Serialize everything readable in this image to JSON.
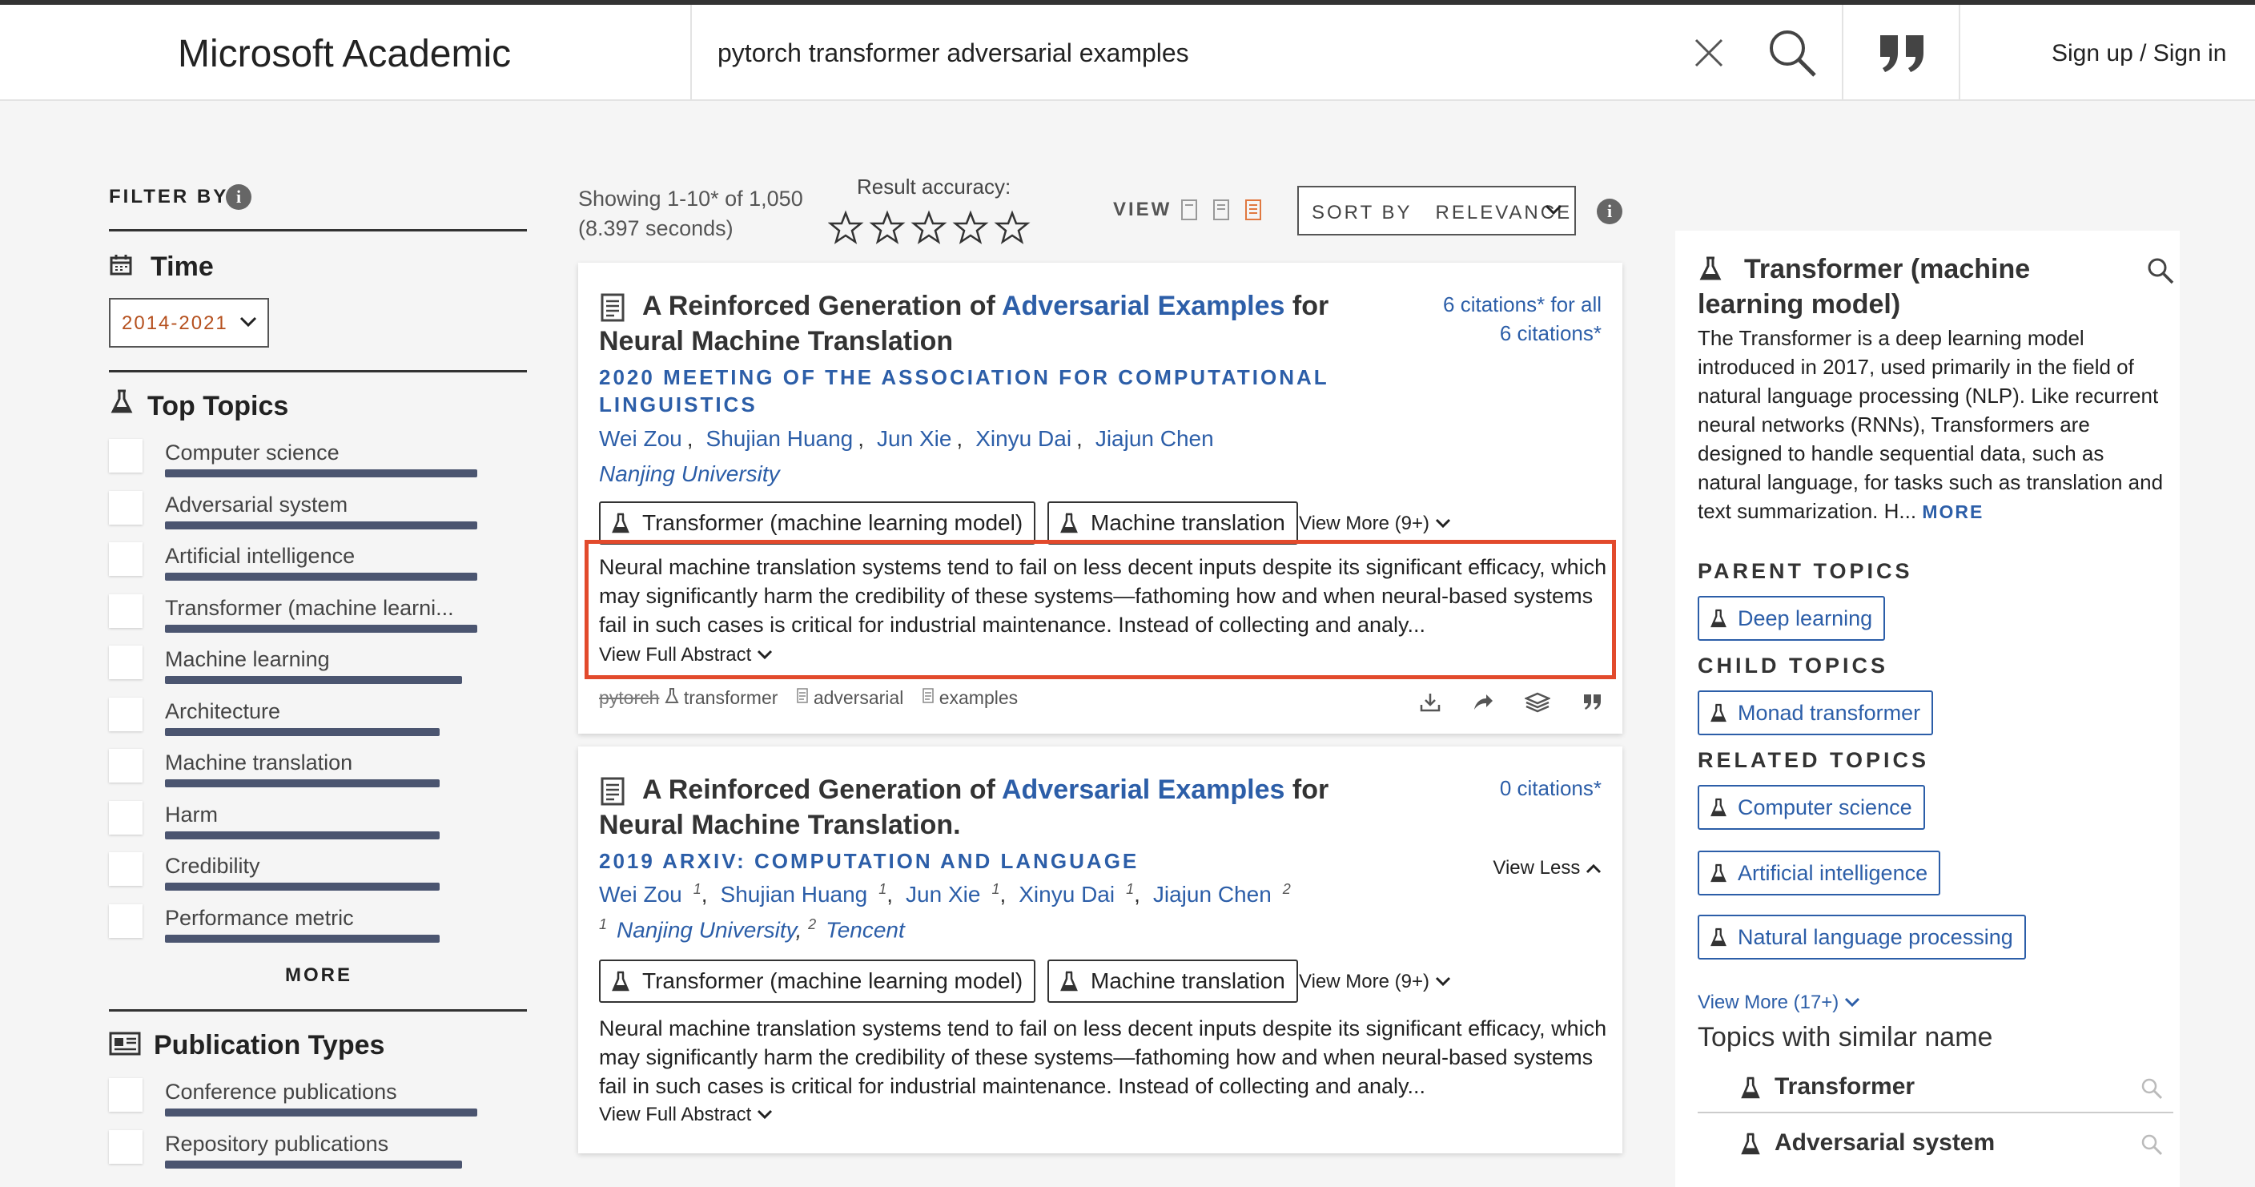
{
  "header": {
    "brand": "Microsoft Academic",
    "search_value": "pytorch transformer adversarial examples",
    "signin": "Sign up / Sign in"
  },
  "filters": {
    "label": "FILTER BY:",
    "time": {
      "title": "Time",
      "selected": "2014-2021"
    },
    "top_topics": {
      "title": "Top Topics",
      "items": [
        {
          "label": "Computer science",
          "weight": 1.0
        },
        {
          "label": "Adversarial system",
          "weight": 1.0
        },
        {
          "label": "Artificial intelligence",
          "weight": 1.0
        },
        {
          "label": "Transformer (machine learni...",
          "weight": 1.0
        },
        {
          "label": "Machine learning",
          "weight": 0.95
        },
        {
          "label": "Architecture",
          "weight": 0.88
        },
        {
          "label": "Machine translation",
          "weight": 0.88
        },
        {
          "label": "Harm",
          "weight": 0.88
        },
        {
          "label": "Credibility",
          "weight": 0.88
        },
        {
          "label": "Performance metric",
          "weight": 0.88
        }
      ],
      "more": "MORE"
    },
    "publication_types": {
      "title": "Publication Types",
      "items": [
        {
          "label": "Conference publications",
          "weight": 1.0
        },
        {
          "label": "Repository publications",
          "weight": 0.95
        }
      ]
    }
  },
  "results_header": {
    "showing": "Showing 1-10* of 1,050",
    "seconds": "(8.397 seconds)",
    "accuracy_label": "Result accuracy:",
    "view_label": "VIEW",
    "sort_label": "SORT BY",
    "sort_value": "RELEVANCE"
  },
  "results": [
    {
      "title_pre": "A Reinforced Generation of ",
      "title_hl": "Adversarial Examples",
      "title_post": " for Neural Machine Translation",
      "cites_line1": "6 citations* for all",
      "cites_line2": "6 citations*",
      "venue": "2020 MEETING OF THE ASSOCIATION FOR COMPUTATIONAL LINGUISTICS",
      "authors": [
        "Wei Zou",
        "Shujian Huang",
        "Jun Xie",
        "Xinyu Dai",
        "Jiajun Chen"
      ],
      "affiliation": "Nanjing University",
      "chips": [
        "Transformer (machine learning model)",
        "Machine translation"
      ],
      "view_more": "View More (9+)",
      "abstract": "Neural machine translation systems tend to fail on less decent inputs despite its significant efficacy, which may significantly harm the credibility of these systems—fathoming how and when neural-based systems fail in such cases is critical for industrial maintenance. Instead of collecting and analy...",
      "full_abstract": "View Full Abstract",
      "keywords": {
        "struck": "pytorch",
        "k1": "transformer",
        "k2": "adversarial",
        "k3": "examples"
      }
    },
    {
      "title_pre": "A Reinforced Generation of ",
      "title_hl": "Adversarial Examples",
      "title_post": " for Neural Machine Translation.",
      "cites_line1": "0 citations*",
      "view_less": "View Less",
      "venue": "2019 ARXIV: COMPUTATION AND LANGUAGE",
      "authors": [
        "Wei Zou",
        "Shujian Huang",
        "Jun Xie",
        "Xinyu Dai",
        "Jiajun Chen"
      ],
      "author_sups": [
        "1",
        "1",
        "1",
        "1",
        "2"
      ],
      "affiliations": [
        {
          "sup": "1",
          "name": "Nanjing University"
        },
        {
          "sup": "2",
          "name": "Tencent"
        }
      ],
      "chips": [
        "Transformer (machine learning model)",
        "Machine translation"
      ],
      "view_more": "View More (9+)",
      "abstract": "Neural machine translation systems tend to fail on less decent inputs despite its significant efficacy, which may significantly harm the credibility of these systems—fathoming how and when neural-based systems fail in such cases is critical for industrial maintenance. Instead of collecting and analy...",
      "full_abstract": "View Full Abstract"
    }
  ],
  "topic_panel": {
    "title": "Transformer (machine learning model)",
    "description": "The Transformer is a deep learning model introduced in 2017, used primarily in the field of natural language processing (NLP). Like recurrent neural networks (RNNs), Transformers are designed to handle sequential data, such as natural language, for tasks such as translation and text summarization. H...",
    "more": "MORE",
    "parent_heading": "PARENT TOPICS",
    "parent_topics": [
      "Deep learning"
    ],
    "child_heading": "CHILD TOPICS",
    "child_topics": [
      "Monad transformer"
    ],
    "related_heading": "RELATED TOPICS",
    "related_topics": [
      "Computer science",
      "Artificial intelligence",
      "Natural language processing"
    ],
    "view_more": "View More (17+)",
    "similar_heading": "Topics with similar name",
    "similar": [
      "Transformer",
      "Adversarial system"
    ]
  },
  "colors": {
    "accent_blue": "#2c5ea8",
    "highlight_red": "#e24a2c",
    "time_orange": "#b5501e",
    "bar": "#4b5570"
  }
}
